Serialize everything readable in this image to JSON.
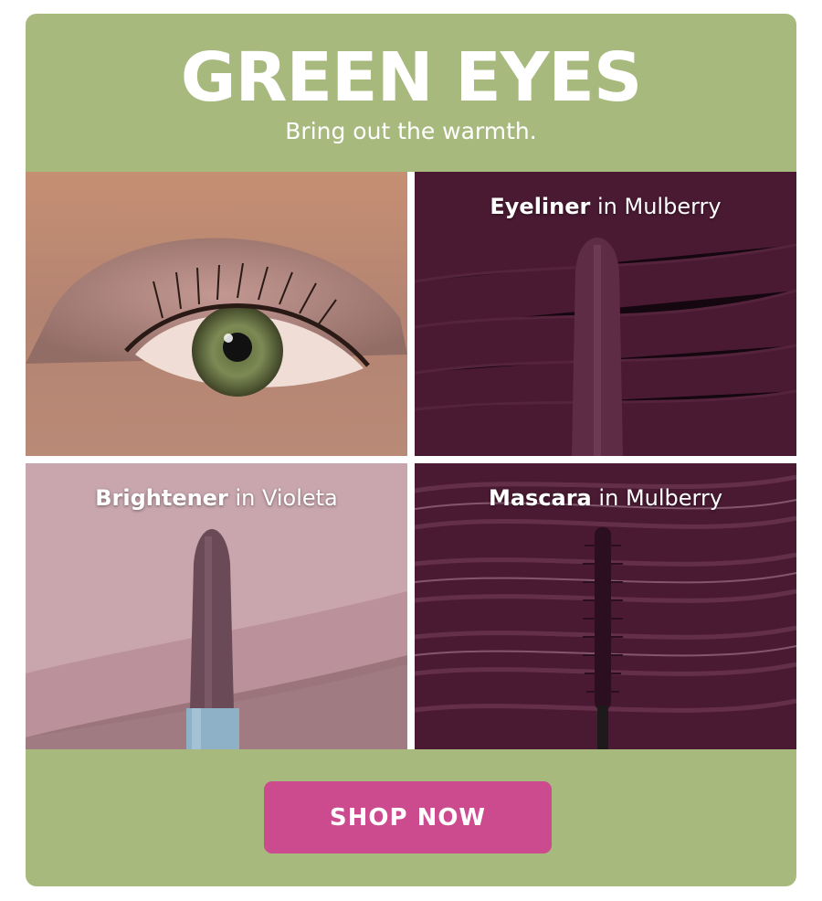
{
  "header": {
    "title": "GREEN EYES",
    "subtitle": "Bring out the warmth."
  },
  "tiles": [
    {
      "image": "eye-closeup-photo"
    },
    {
      "product": "Eyeliner",
      "joiner": "in",
      "shade": "Mulberry",
      "image": "eyeliner-pencil-on-swatch"
    },
    {
      "product": "Brightener",
      "joiner": "in",
      "shade": "Violeta",
      "image": "brightener-stick-on-swatch"
    },
    {
      "product": "Mascara",
      "joiner": "in",
      "shade": "Mulberry",
      "image": "mascara-wand-on-swatch"
    }
  ],
  "cta": {
    "label": "SHOP NOW"
  },
  "colors": {
    "background": "#a8b97e",
    "button": "#cc4a8e",
    "mulberry": "#4a1a33",
    "violeta": "#c9a6ae"
  }
}
